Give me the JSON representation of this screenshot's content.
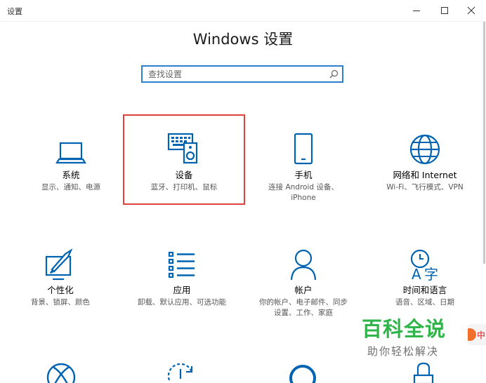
{
  "window": {
    "title": "设置"
  },
  "heading": "Windows 设置",
  "search": {
    "placeholder": "查找设置"
  },
  "tiles": [
    {
      "name": "系统",
      "desc1": "显示、通知、电源",
      "desc2": "",
      "icon": "laptop-icon"
    },
    {
      "name": "设备",
      "desc1": "蓝牙、打印机、鼠标",
      "desc2": "",
      "icon": "devices-icon"
    },
    {
      "name": "手机",
      "desc1": "连接 Android 设备、",
      "desc2": "iPhone",
      "icon": "phone-icon"
    },
    {
      "name": "网络和 Internet",
      "desc1": "Wi-Fi、飞行模式、VPN",
      "desc2": "",
      "icon": "globe-icon"
    },
    {
      "name": "个性化",
      "desc1": "背景、锁屏、颜色",
      "desc2": "",
      "icon": "personalization-icon"
    },
    {
      "name": "应用",
      "desc1": "卸载、默认应用、可选功能",
      "desc2": "",
      "icon": "apps-list-icon"
    },
    {
      "name": "帐户",
      "desc1": "你的帐户、电子邮件、同步",
      "desc2": "设置、工作、家庭",
      "icon": "person-icon"
    },
    {
      "name": "时间和语言",
      "desc1": "语音、区域、日期",
      "desc2": "",
      "icon": "time-language-icon"
    }
  ],
  "watermark": {
    "title": "百科全说",
    "subtitle": "助你轻松解决",
    "badge": "中"
  },
  "colors": {
    "accent": "#0063b1",
    "selection": "#e0413a",
    "search_border": "#2f7fcf",
    "watermark_green": "#2fb54a"
  }
}
